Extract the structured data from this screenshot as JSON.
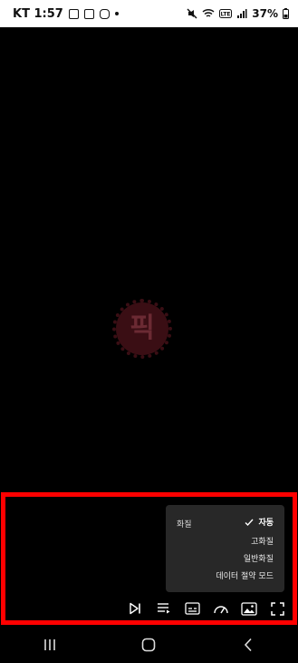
{
  "status_bar": {
    "carrier_time": "KT 1:57",
    "battery": "37%",
    "icons": [
      "notification-icon",
      "gallery-icon",
      "instagram-icon",
      "dot-icon",
      "mute-icon",
      "wifi-icon",
      "volte-icon",
      "signal-icon",
      "battery-icon"
    ]
  },
  "watermark": {
    "text": "픽"
  },
  "quality_menu": {
    "title": "화질",
    "selected": "자동",
    "options": [
      "고화질",
      "일반화질",
      "데이터 절약 모드"
    ]
  },
  "controls": {
    "icons": [
      "next-icon",
      "playlist-icon",
      "subtitles-icon",
      "speed-icon",
      "picture-icon",
      "fullscreen-icon"
    ]
  },
  "nav_bar": {
    "icons": [
      "recents-icon",
      "home-icon",
      "back-icon"
    ]
  },
  "colors": {
    "highlight": "#ff0000",
    "menu_bg": "#282828",
    "watermark": "#3a0e14"
  }
}
